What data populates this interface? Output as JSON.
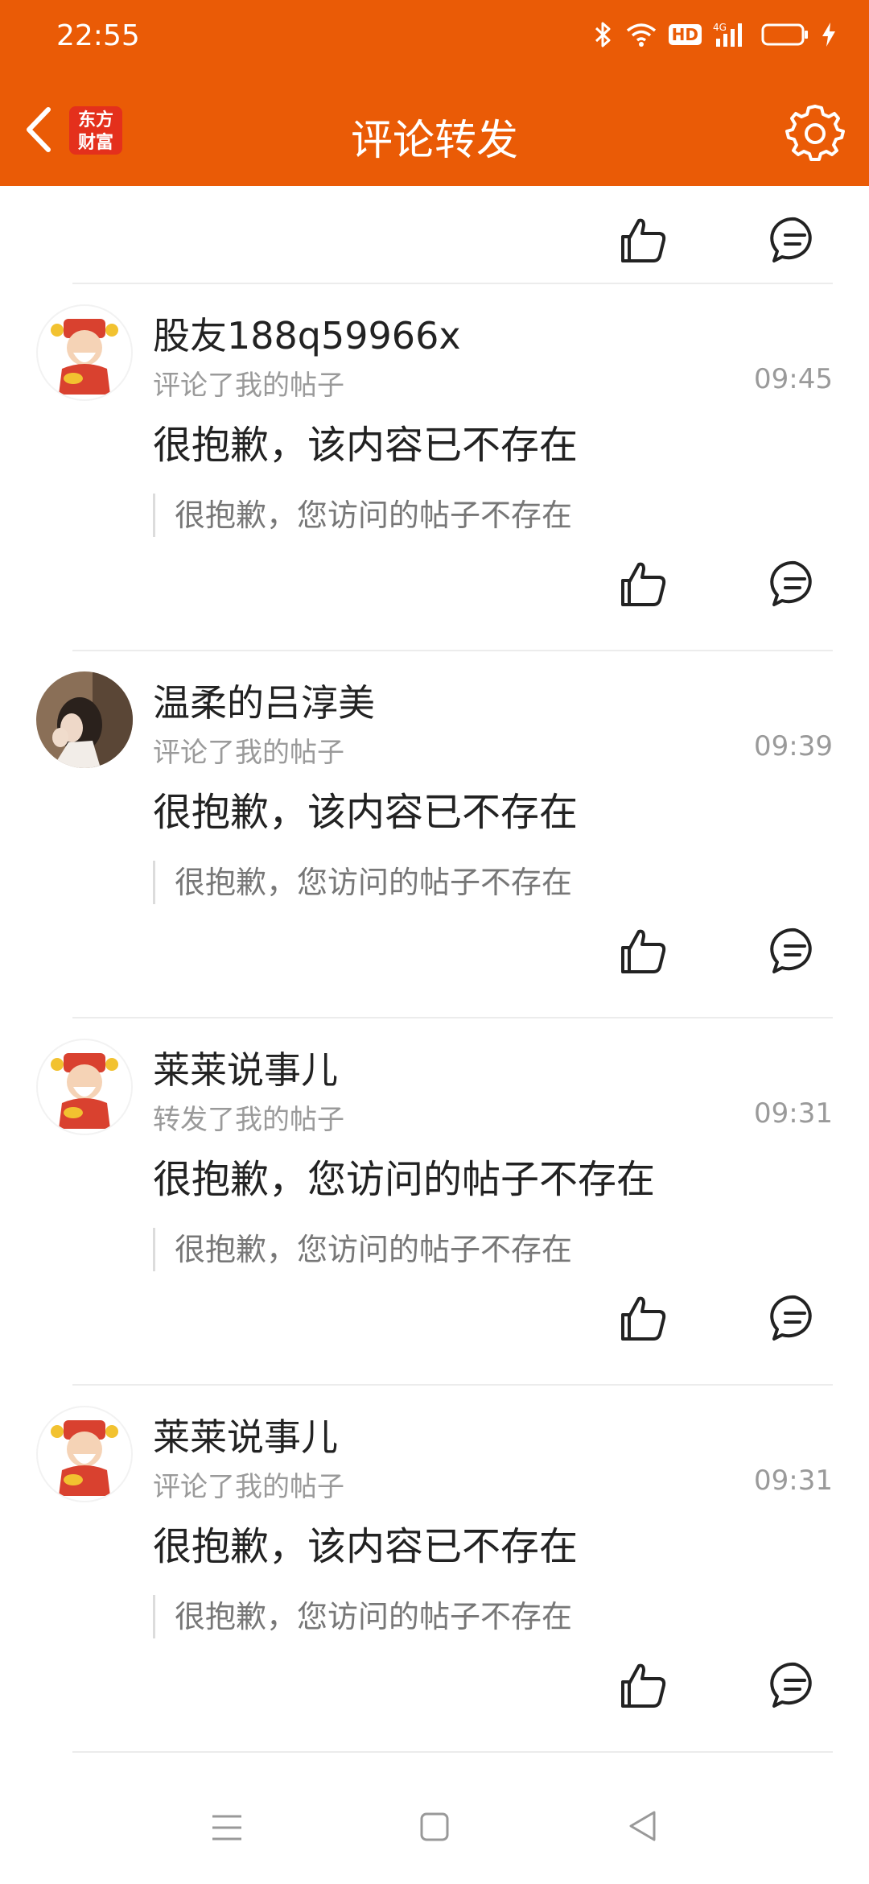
{
  "status_bar": {
    "time": "22:55",
    "icons": [
      "bluetooth-icon",
      "wifi-icon",
      "hd-badge",
      "4g-signal-icon",
      "battery-icon",
      "charging-icon"
    ],
    "hd_label": "HD",
    "network_label": "4G"
  },
  "app_bar": {
    "logo_line1": "东方",
    "logo_line2": "财富",
    "title": "评论转发",
    "accent_color": "#ea5b06"
  },
  "notifications": [
    {
      "username": "股友188q59966x",
      "action": "评论了我的帖子",
      "time": "09:45",
      "content": "很抱歉，该内容已不存在",
      "quote": "很抱歉，您访问的帖子不存在",
      "avatar": "god-of-wealth-avatar"
    },
    {
      "username": "温柔的吕淳美",
      "action": "评论了我的帖子",
      "time": "09:39",
      "content": "很抱歉，该内容已不存在",
      "quote": "很抱歉，您访问的帖子不存在",
      "avatar": "photo-avatar"
    },
    {
      "username": "莱莱说事儿",
      "action": "转发了我的帖子",
      "time": "09:31",
      "content": "很抱歉，您访问的帖子不存在",
      "quote": "很抱歉，您访问的帖子不存在",
      "avatar": "god-of-wealth-avatar"
    },
    {
      "username": "莱莱说事儿",
      "action": "评论了我的帖子",
      "time": "09:31",
      "content": "很抱歉，该内容已不存在",
      "quote": "很抱歉，您访问的帖子不存在",
      "avatar": "god-of-wealth-avatar"
    }
  ],
  "nav_bar": {
    "buttons": [
      "menu-icon",
      "home-icon",
      "back-icon"
    ]
  }
}
